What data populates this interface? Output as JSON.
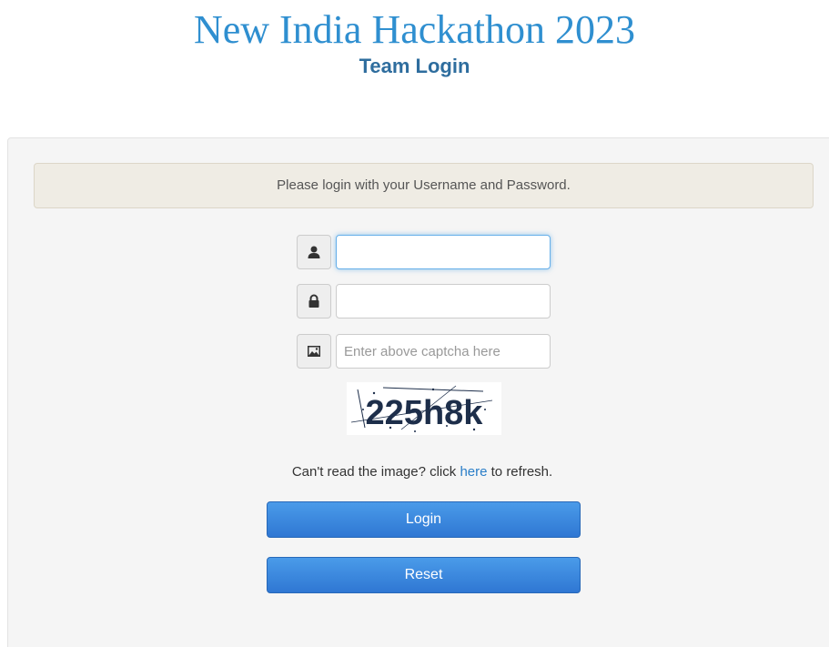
{
  "header": {
    "title": "New India Hackathon 2023",
    "subtitle": "Team Login"
  },
  "login": {
    "notice": "Please login with your Username and Password.",
    "username": {
      "icon": "user-icon",
      "value": ""
    },
    "password": {
      "icon": "lock-icon",
      "value": ""
    },
    "captcha": {
      "icon": "image-icon",
      "placeholder": "Enter above captcha here",
      "image_text": "225h8k"
    },
    "refresh": {
      "prefix": "Can't read the image? click ",
      "link": "here",
      "suffix": " to refresh."
    },
    "buttons": {
      "login": "Login",
      "reset": "Reset"
    }
  },
  "colors": {
    "title": "#2f8fd0",
    "subtitle": "#2e6d9e",
    "button": "#3a86dd",
    "link": "#2a7ec8"
  }
}
